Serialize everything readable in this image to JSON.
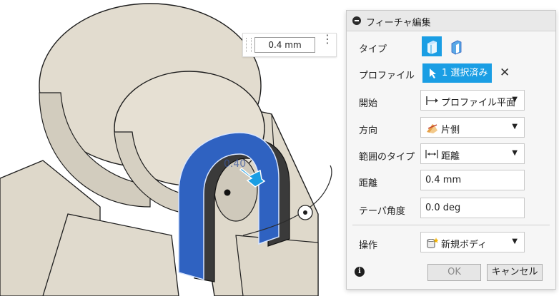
{
  "viewport": {
    "dimension_label": "0.40",
    "mini_toolbar": {
      "value": "0.4 mm",
      "more_glyph": "⋮"
    }
  },
  "dialog": {
    "title": "フィーチャ編集",
    "rows": {
      "type_label": "タイプ",
      "profile_label": "プロファイル",
      "profile_button": "1 選択済み",
      "clear_glyph": "✕",
      "start_label": "開始",
      "start_value": "プロファイル平面",
      "direction_label": "方向",
      "direction_value": "片側",
      "extent_label": "範囲のタイプ",
      "extent_value": "距離",
      "distance_label": "距離",
      "distance_value": "0.4 mm",
      "taper_label": "テーパ角度",
      "taper_value": "0.0 deg",
      "operation_label": "操作",
      "operation_value": "新規ボディ"
    },
    "footer": {
      "info_glyph": "i",
      "ok_label": "OK",
      "cancel_label": "キャンセル"
    }
  },
  "colors": {
    "accent": "#1a9ee4",
    "extrude_blue": "#2f62c1",
    "model_beige": "#e3ddd0"
  }
}
